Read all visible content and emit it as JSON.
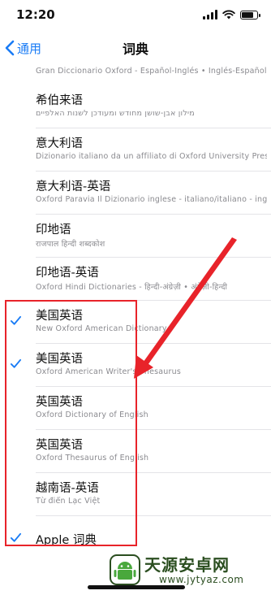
{
  "status_bar": {
    "time": "12:20"
  },
  "nav": {
    "back_label": "通用",
    "title": "词典"
  },
  "partial_subtitle": "Gran Diccionario Oxford - Español-Inglés • Inglés-Español",
  "dictionaries": [
    {
      "title": "希伯来语",
      "subtitle": "מילון אבן-שושן מחודש ומעודכן לשנות האלפיים",
      "checked": false
    },
    {
      "title": "意大利语",
      "subtitle": "Dizionario italiano da un affiliato di Oxford University Press",
      "checked": false
    },
    {
      "title": "意大利语-英语",
      "subtitle": "Oxford Paravia Il Dizionario inglese - italiano/italiano - inglese",
      "checked": false
    },
    {
      "title": "印地语",
      "subtitle": "राजपाल हिन्दी शब्दकोश",
      "checked": false
    },
    {
      "title": "印地语-英语",
      "subtitle": "Oxford Hindi Dictionaries - हिन्दी-अंग्रेज़ी • अंग्रेज़ी-हिन्दी",
      "checked": false
    },
    {
      "title": "美国英语",
      "subtitle": "New Oxford American Dictionary",
      "checked": true
    },
    {
      "title": "美国英语",
      "subtitle": "Oxford American Writer's Thesaurus",
      "checked": true
    },
    {
      "title": "英国英语",
      "subtitle": "Oxford Dictionary of English",
      "checked": false
    },
    {
      "title": "英国英语",
      "subtitle": "Oxford Thesaurus of English",
      "checked": false
    },
    {
      "title": "越南语-英语",
      "subtitle": "Từ điển Lạc Việt",
      "checked": false
    },
    {
      "title": "Apple 词典",
      "subtitle": "",
      "checked": true
    }
  ],
  "colors": {
    "accent": "#1a7cf5",
    "highlight": "#e8232a",
    "watermark": "#2b4e20"
  },
  "watermark": {
    "title": "天源安卓网",
    "url": "www.jytyaz.com"
  }
}
